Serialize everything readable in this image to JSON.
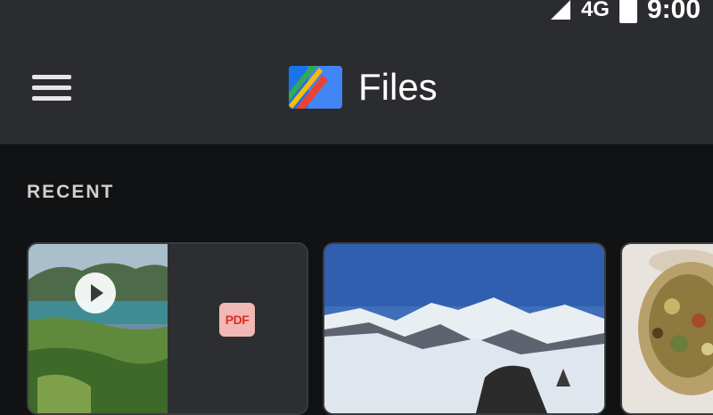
{
  "status_bar": {
    "network": "4G",
    "time": "9:00",
    "icons": [
      "signal-icon",
      "battery-icon"
    ]
  },
  "app_bar": {
    "menu_icon": "hamburger-menu-icon",
    "logo_icon": "files-logo-icon",
    "title": "Files"
  },
  "recent": {
    "label": "RECENT",
    "items": [
      {
        "type": "video",
        "icon": "play-icon"
      },
      {
        "type": "pdf",
        "badge": "PDF"
      },
      {
        "type": "image"
      },
      {
        "type": "image"
      }
    ]
  },
  "colors": {
    "app_bar": "#2b2c2f",
    "background": "#111214",
    "pdf_badge_bg": "#f2b8b5",
    "pdf_badge_text": "#d93025"
  }
}
